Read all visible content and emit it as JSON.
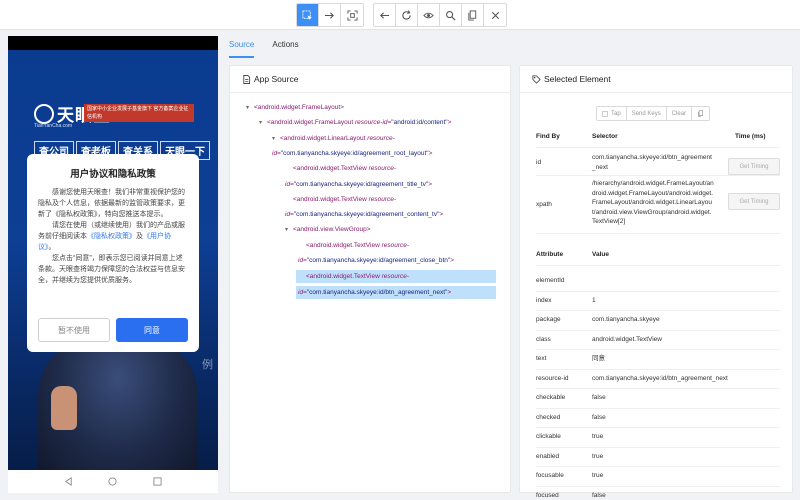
{
  "toolbar": {
    "group1": [
      {
        "icon": "select-element-icon",
        "active": true
      },
      {
        "icon": "swipe-arrow-icon",
        "active": false
      },
      {
        "icon": "tap-by-coordinates-icon",
        "active": false
      }
    ],
    "group2": [
      {
        "icon": "back-arrow-icon"
      },
      {
        "icon": "refresh-icon"
      },
      {
        "icon": "eye-icon"
      },
      {
        "icon": "search-icon"
      },
      {
        "icon": "copy-xml-icon"
      },
      {
        "icon": "close-icon"
      }
    ]
  },
  "phone": {
    "logo_text": "天眼查",
    "logo_sub": "TianYanCha.com",
    "slogan": "国家中小企业发展子基金旗下 官方备案企业征信机构",
    "banner": [
      "查公司",
      "查老板",
      "查关系",
      "天眼一下"
    ],
    "side_char": "例",
    "dialog": {
      "title": "用户协议和隐私政策",
      "para1": "感谢您使用天眼查！我们非常重视保护您的隐私及个人信息，依据最新的监管政策要求，更新了《隐私权政策》，特向您推送本提示。",
      "para2_prefix": "请您在使用（或继续使用）我们的产品或服务前仔细阅读本",
      "para2_link1": "《隐私权政策》",
      "para2_and": "及",
      "para2_link2": "《用户协议》",
      "para2_suffix": "。",
      "para3": "您点击“同意”，即表示您已阅读并同意上述条款。天眼查将竭力保障您的合法权益与信息安全，并继续为您提供优质服务。",
      "reject_label": "暂不使用",
      "agree_label": "同意"
    }
  },
  "tabs": [
    {
      "label": "Source",
      "active": true
    },
    {
      "label": "Actions",
      "active": false
    }
  ],
  "source_panel": {
    "title": "App Source",
    "tree": [
      {
        "depth": 0,
        "arrow": "▾",
        "tag": "<android.widget.FrameLayout>",
        "attr": "",
        "val": "",
        "tail": "",
        "selected": false
      },
      {
        "depth": 1,
        "arrow": "▾",
        "tag": "<android.widget.FrameLayout ",
        "attr": "resource-id=",
        "val": "\"android:id/content\"",
        "tail": ">",
        "selected": false
      },
      {
        "depth": 2,
        "arrow": "▾",
        "tag": "<android.widget.LinearLayout ",
        "attr": "resource-",
        "val": "",
        "tail": "",
        "selected": false
      },
      {
        "depth": 2,
        "arrow": "",
        "tag": "",
        "attr": "id=",
        "val": "\"com.tianyancha.skyeye:id/agreement_root_layout\"",
        "tail": ">",
        "selected": false,
        "cont": true
      },
      {
        "depth": 3,
        "arrow": "",
        "tag": "<android.widget.TextView ",
        "attr": "resource-",
        "val": "",
        "tail": "",
        "selected": false
      },
      {
        "depth": 3,
        "arrow": "",
        "tag": "",
        "attr": "id=",
        "val": "\"com.tianyancha.skyeye:id/agreement_title_tv\"",
        "tail": ">",
        "selected": false,
        "cont": true
      },
      {
        "depth": 3,
        "arrow": "",
        "tag": "<android.widget.TextView ",
        "attr": "resource-",
        "val": "",
        "tail": "",
        "selected": false
      },
      {
        "depth": 3,
        "arrow": "",
        "tag": "",
        "attr": "id=",
        "val": "\"com.tianyancha.skyeye:id/agreement_content_tv\"",
        "tail": ">",
        "selected": false,
        "cont": true
      },
      {
        "depth": 3,
        "arrow": "▾",
        "tag": "<android.view.ViewGroup>",
        "attr": "",
        "val": "",
        "tail": "",
        "selected": false
      },
      {
        "depth": 4,
        "arrow": "",
        "tag": "<android.widget.TextView ",
        "attr": "resource-",
        "val": "",
        "tail": "",
        "selected": false
      },
      {
        "depth": 4,
        "arrow": "",
        "tag": "",
        "attr": "id=",
        "val": "\"com.tianyancha.skyeye:id/agreement_close_btn\"",
        "tail": ">",
        "selected": false,
        "cont": true
      },
      {
        "depth": 4,
        "arrow": "",
        "tag": "<android.widget.TextView ",
        "attr": "resource-",
        "val": "",
        "tail": "",
        "selected": true
      },
      {
        "depth": 4,
        "arrow": "",
        "tag": "",
        "attr": "id=",
        "val": "\"com.tianyancha.skyeye:id/btn_agreement_next\"",
        "tail": ">",
        "selected": true,
        "cont": true
      }
    ]
  },
  "selected_panel": {
    "title": "Selected Element",
    "buttons": [
      "Tap",
      "Send Keys",
      "Clear"
    ],
    "find_headers": {
      "find_by": "Find By",
      "selector": "Selector",
      "time": "Time (ms)"
    },
    "find_rows": [
      {
        "by": "id",
        "selector": "com.tianyancha.skyeye:id/btn_agreement_next",
        "action": "Get Timing"
      },
      {
        "by": "xpath",
        "selector": "/hierarchy/android.widget.FrameLayout/android.widget.FrameLayout/android.widget.FrameLayout/android.widget.LinearLayout/android.view.ViewGroup/android.widget.TextView[2]",
        "action": "Get Timing"
      }
    ],
    "attr_headers": {
      "attribute": "Attribute",
      "value": "Value"
    },
    "attributes": [
      {
        "name": "elementId",
        "value": ""
      },
      {
        "name": "index",
        "value": "1"
      },
      {
        "name": "package",
        "value": "com.tianyancha.skyeye"
      },
      {
        "name": "class",
        "value": "android.widget.TextView"
      },
      {
        "name": "text",
        "value": "同意"
      },
      {
        "name": "resource-id",
        "value": "com.tianyancha.skyeye:id/btn_agreement_next"
      },
      {
        "name": "checkable",
        "value": "false"
      },
      {
        "name": "checked",
        "value": "false"
      },
      {
        "name": "clickable",
        "value": "true"
      },
      {
        "name": "enabled",
        "value": "true"
      },
      {
        "name": "focusable",
        "value": "true"
      },
      {
        "name": "focused",
        "value": "false"
      }
    ]
  },
  "colors": {
    "accent": "#3b8ff5",
    "selected_row": "#bfe0fb",
    "tag": "#8b1b6f",
    "value": "#1a237e",
    "brand_blue": "#0a3b8f"
  }
}
